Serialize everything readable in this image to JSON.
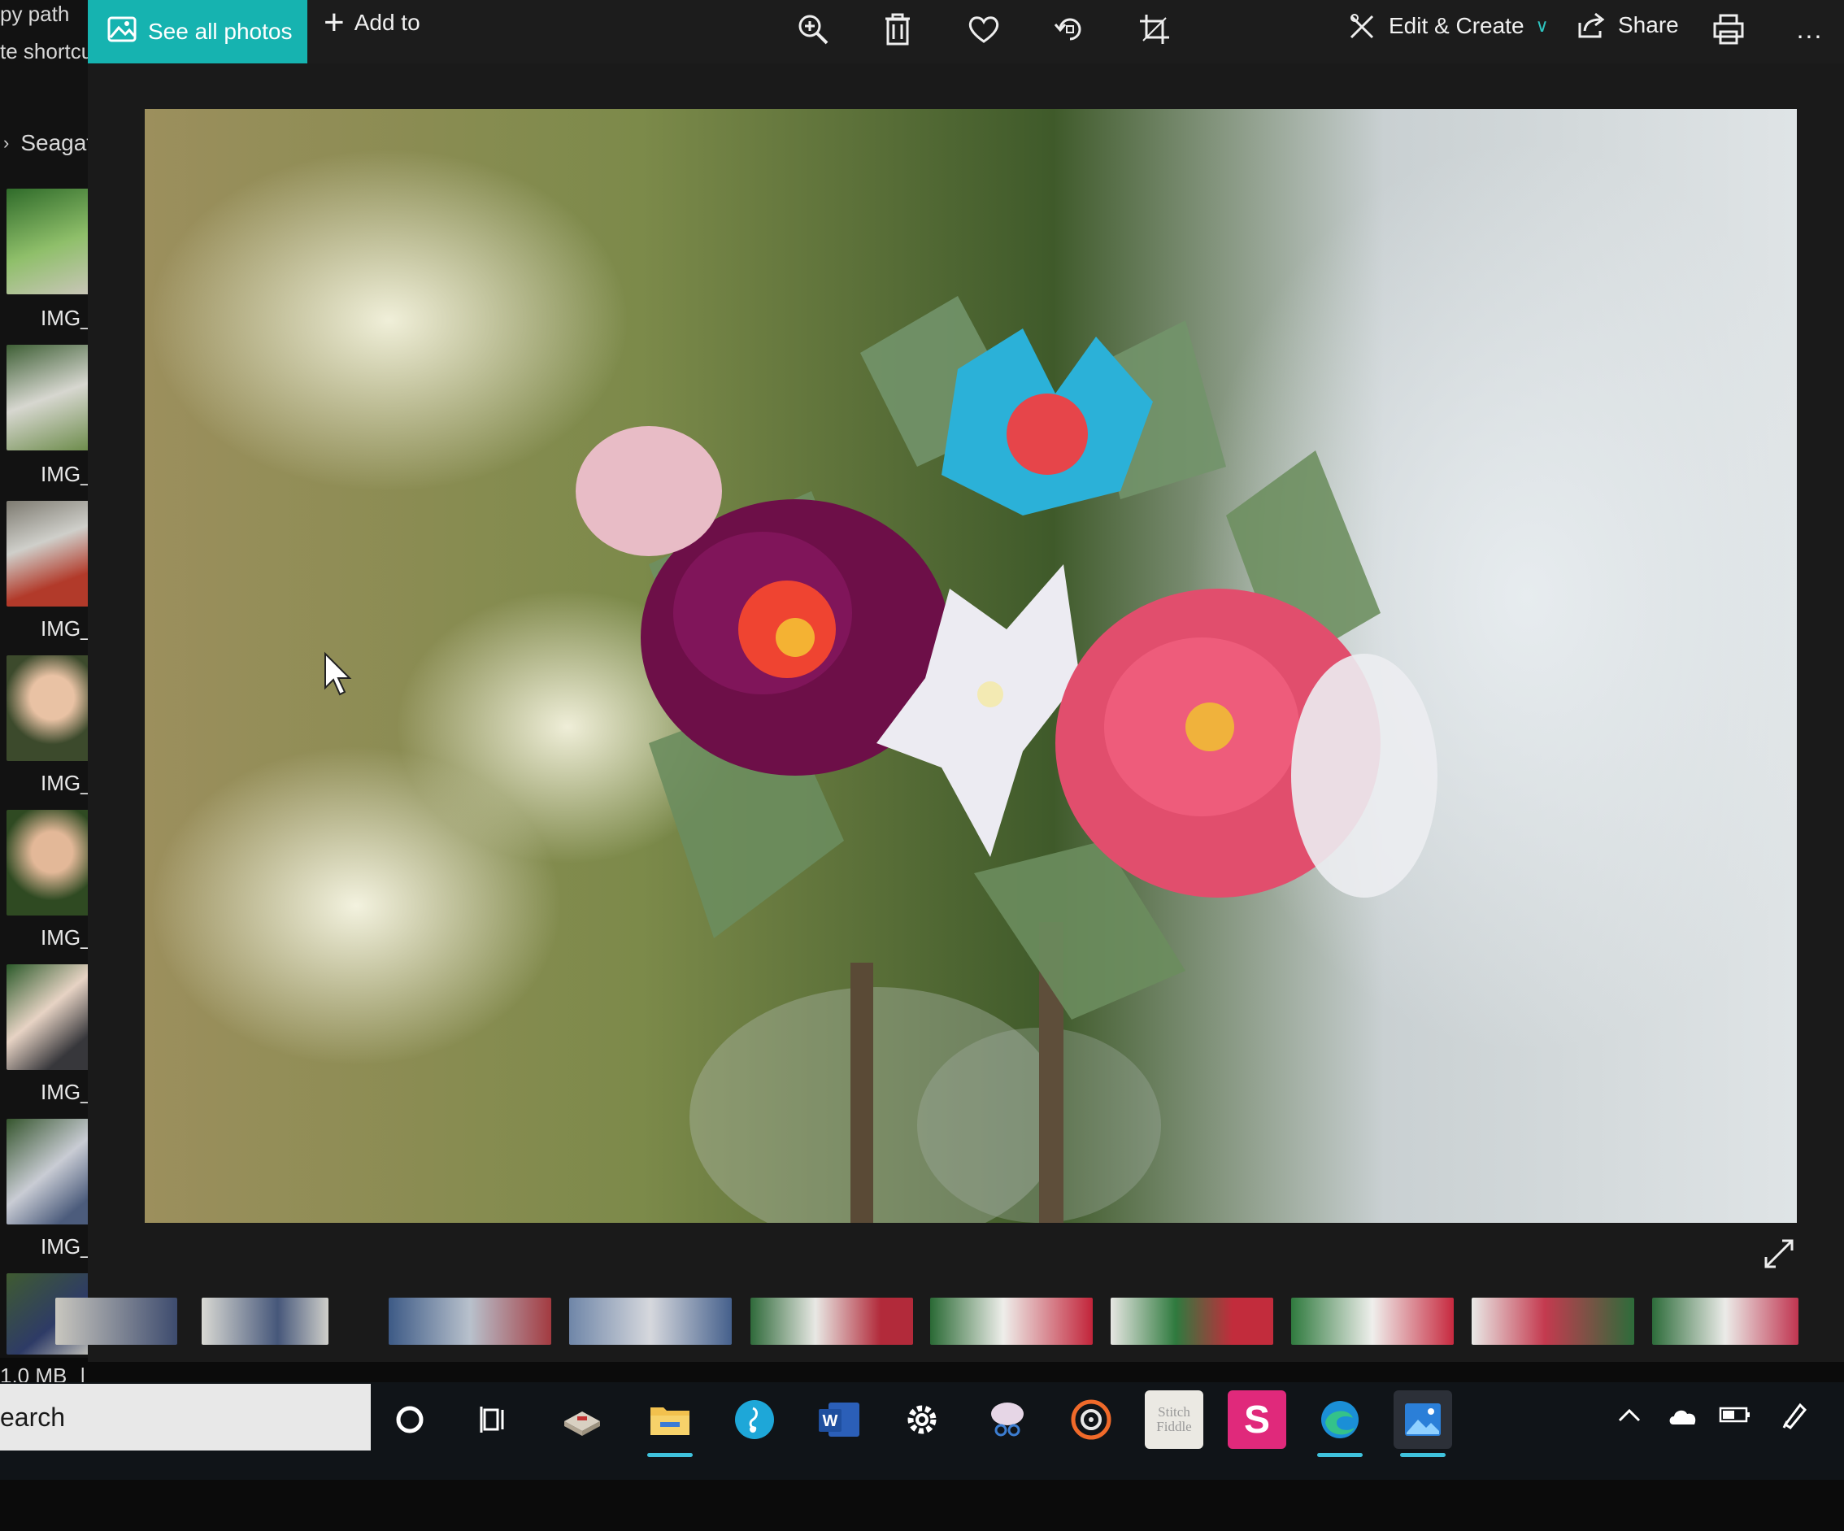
{
  "explorer": {
    "path_text": "py path",
    "shortcut_text": "te shortcu",
    "drive_label": "Seagat",
    "thumb_labels": [
      "IMG_",
      "IMG_",
      "IMG_",
      "IMG_",
      "IMG_",
      "IMG_",
      "IMG_"
    ]
  },
  "toolbar": {
    "see_all_label": "See all photos",
    "add_to_label": "Add to",
    "edit_create_label": "Edit & Create",
    "share_label": "Share",
    "more_label": "..."
  },
  "status": {
    "size_text": "1.0 MB",
    "separator": "|"
  },
  "taskbar": {
    "search_text": "earch",
    "stitch_fiddle_label": "Stitch Fiddle"
  },
  "colors": {
    "accent": "#16b3b0",
    "taskbar_indicator": "#3fc2dc",
    "app_bg": "#1a1a1a"
  }
}
